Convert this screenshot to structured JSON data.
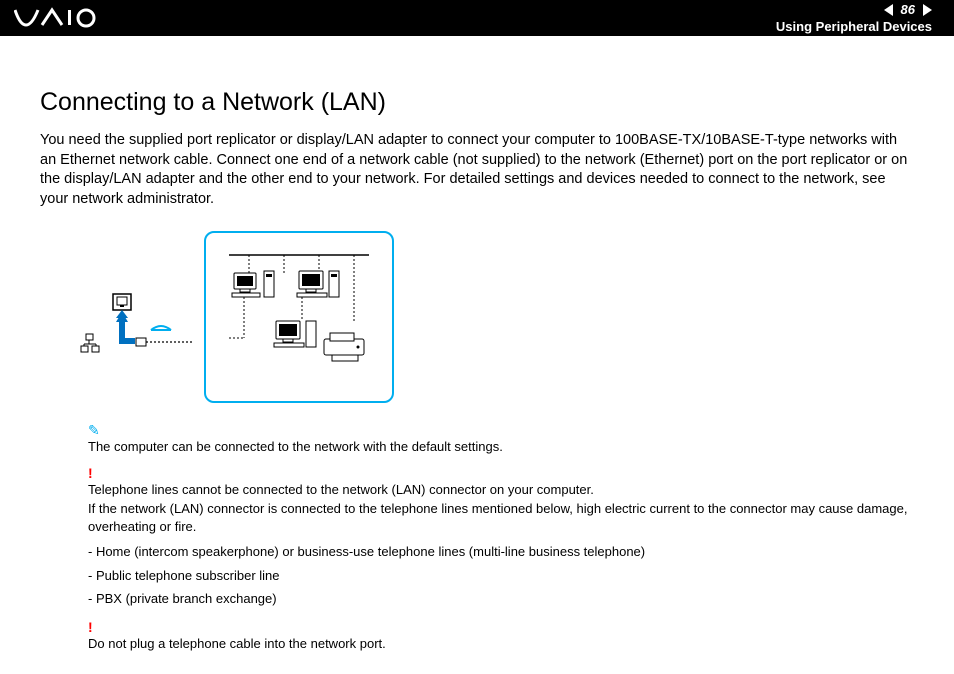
{
  "header": {
    "logo_text": "VAIO",
    "page_number": "86",
    "section": "Using Peripheral Devices"
  },
  "title": "Connecting to a Network (LAN)",
  "intro": "You need the supplied port replicator or display/LAN adapter to connect your computer to 100BASE-TX/10BASE-T-type networks with an Ethernet network cable. Connect one end of a network cable (not supplied) to the network (Ethernet) port on the port replicator or on the display/LAN adapter and the other end to your network. For detailed settings and devices needed to connect to the network, see your network administrator.",
  "notes": {
    "pen_note": "The computer can be connected to the network with the default settings.",
    "warn1_line1": "Telephone lines cannot be connected to the network (LAN) connector on your computer.",
    "warn1_line2": "If the network (LAN) connector is connected to the telephone lines mentioned below, high electric current to the connector may cause damage, overheating or fire.",
    "list": [
      "- Home (intercom speakerphone) or business-use telephone lines (multi-line business telephone)",
      "- Public telephone subscriber line",
      "- PBX (private branch exchange)"
    ],
    "warn2": "Do not plug a telephone cable into the network port."
  }
}
